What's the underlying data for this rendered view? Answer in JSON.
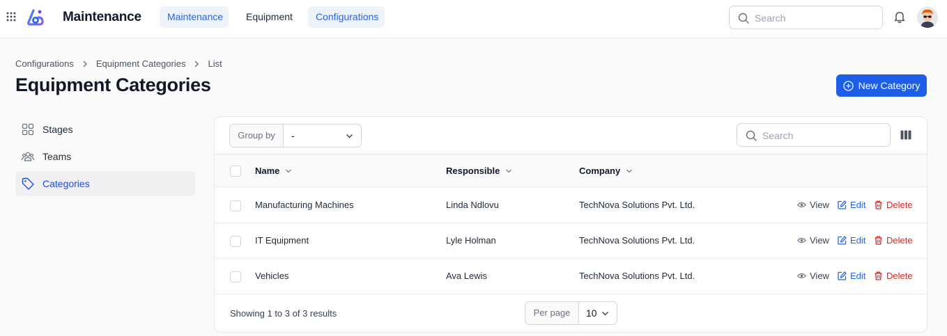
{
  "header": {
    "app_title": "Maintenance",
    "tabs": [
      {
        "label": "Maintenance",
        "active": true
      },
      {
        "label": "Equipment",
        "active": false
      },
      {
        "label": "Configurations",
        "active": true
      }
    ],
    "search_placeholder": "Search"
  },
  "breadcrumb": [
    "Configurations",
    "Equipment Categories",
    "List"
  ],
  "page_title": "Equipment Categories",
  "new_button_label": "New Category",
  "sidebar": {
    "items": [
      {
        "label": "Stages",
        "icon": "grid-icon",
        "active": false
      },
      {
        "label": "Teams",
        "icon": "users-icon",
        "active": false
      },
      {
        "label": "Categories",
        "icon": "tag-icon",
        "active": true
      }
    ]
  },
  "table": {
    "group_by_label": "Group by",
    "group_by_value": "-",
    "search_placeholder": "Search",
    "columns": [
      "Name",
      "Responsible",
      "Company"
    ],
    "rows": [
      {
        "name": "Manufacturing Machines",
        "responsible": "Linda Ndlovu",
        "company": "TechNova Solutions Pvt. Ltd."
      },
      {
        "name": "IT Equipment",
        "responsible": "Lyle Holman",
        "company": "TechNova Solutions Pvt. Ltd."
      },
      {
        "name": "Vehicles",
        "responsible": "Ava Lewis",
        "company": "TechNova Solutions Pvt. Ltd."
      }
    ],
    "actions": {
      "view": "View",
      "edit": "Edit",
      "delete": "Delete"
    },
    "footer_text": "Showing 1 to 3 of 3 results",
    "per_page_label": "Per page",
    "per_page_value": "10"
  },
  "colors": {
    "accent": "#1d5ee8",
    "link": "#2563eb",
    "danger": "#dc2626"
  }
}
